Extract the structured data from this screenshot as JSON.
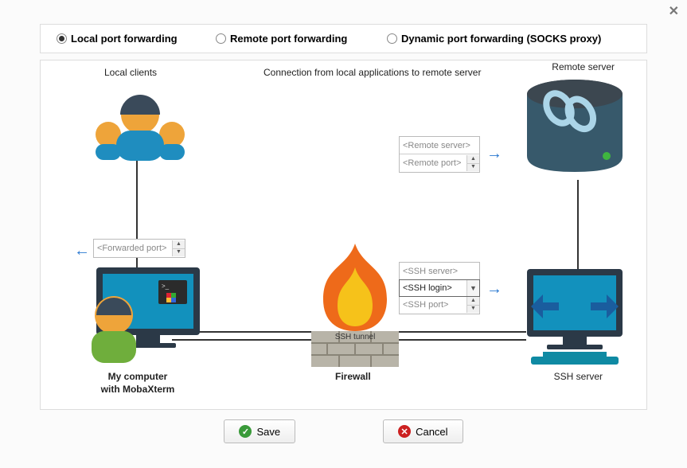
{
  "close": "✕",
  "tabs": {
    "local": "Local port forwarding",
    "remote": "Remote port forwarding",
    "dynamic": "Dynamic port forwarding (SOCKS proxy)"
  },
  "diagram": {
    "title": "Connection from local applications to remote server",
    "local_clients": "Local clients",
    "remote_server": "Remote server",
    "firewall": "Firewall",
    "ssh_tunnel": "SSH tunnel",
    "ssh_server": "SSH server",
    "my_computer_l1": "My computer",
    "my_computer_l2": "with MobaXterm"
  },
  "inputs": {
    "forwarded_port": "<Forwarded port>",
    "remote_server": "<Remote server>",
    "remote_port": "<Remote port>",
    "ssh_server": "<SSH server>",
    "ssh_login": "<SSH login>",
    "ssh_port": "<SSH port>"
  },
  "buttons": {
    "save": "Save",
    "cancel": "Cancel"
  }
}
